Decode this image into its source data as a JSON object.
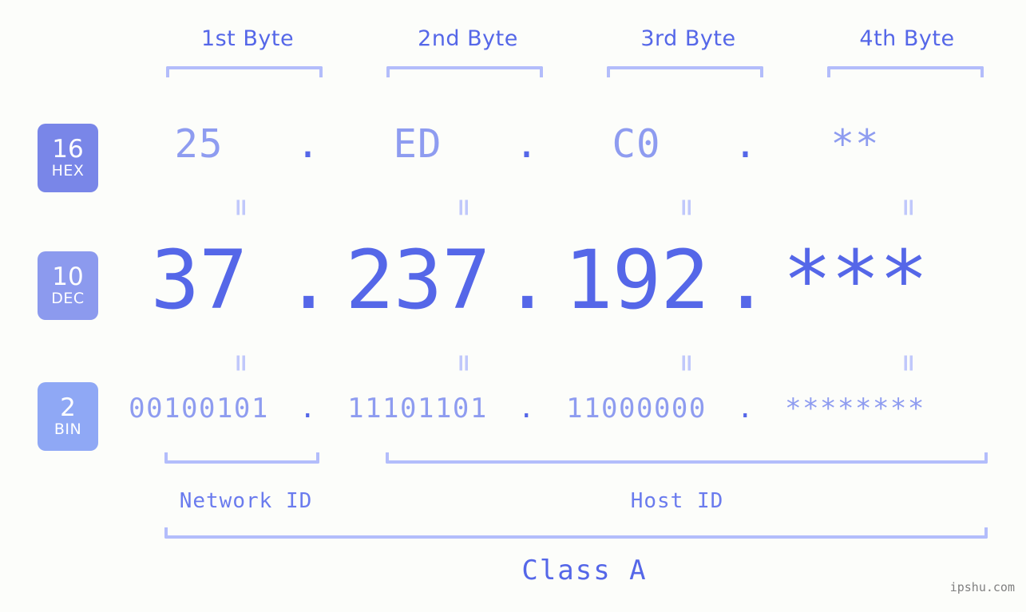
{
  "background_color": "#fcfdfa",
  "accent_color": "#5567e8",
  "accent_light_color": "#8e9cf0",
  "bracket_color": "#b3bdfb",
  "header": {
    "bytes": [
      {
        "label": "1st Byte"
      },
      {
        "label": "2nd Byte"
      },
      {
        "label": "3rd Byte"
      },
      {
        "label": "4th Byte"
      }
    ]
  },
  "bases": [
    {
      "number": "16",
      "name": "HEX",
      "color": "#7986e8"
    },
    {
      "number": "10",
      "name": "DEC",
      "color": "#8c9aee"
    },
    {
      "number": "2",
      "name": "BIN",
      "color": "#8fa8f5"
    }
  ],
  "rows": {
    "hex": {
      "values": [
        "25",
        "ED",
        "C0",
        "**"
      ],
      "separators": [
        ".",
        ".",
        "."
      ]
    },
    "dec": {
      "values": [
        "37",
        "237",
        "192",
        "***"
      ],
      "separators": [
        ".",
        ".",
        "."
      ]
    },
    "bin": {
      "values": [
        "00100101",
        "11101101",
        "11000000",
        "********"
      ],
      "separators": [
        ".",
        ".",
        "."
      ]
    }
  },
  "equals": {
    "symbol": "=",
    "hex_to_dec": [
      "=",
      "=",
      "=",
      "="
    ],
    "dec_to_bin": [
      "=",
      "=",
      "=",
      "="
    ]
  },
  "footer": {
    "network_id_label": "Network ID",
    "host_id_label": "Host ID",
    "class_label": "Class A",
    "watermark": "ipshu.com"
  }
}
